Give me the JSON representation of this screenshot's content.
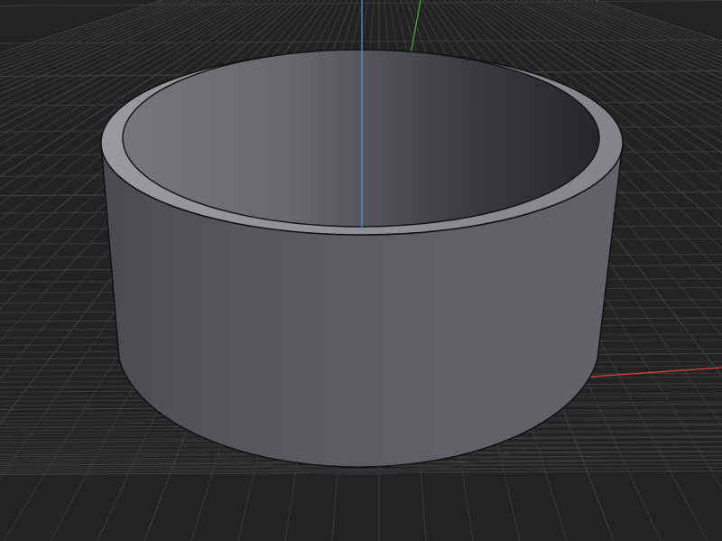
{
  "viewport": {
    "background": "#232323",
    "grid_visible": true,
    "grid_color": "#383838",
    "grid_major_color": "#424242"
  },
  "axes": {
    "x_axis_color": "#d8413a",
    "y_axis_color": "#49a33c",
    "z_axis_color": "#4a8fe0"
  },
  "model": {
    "object": "hollow-cylinder",
    "shading": "solid",
    "body_color": "#5c5c62",
    "rim_color": "#8a8a8f",
    "edge_color": "#111111"
  }
}
